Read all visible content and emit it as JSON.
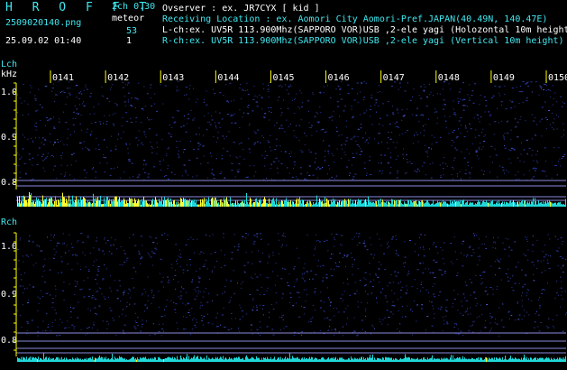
{
  "header": {
    "title": "H R O F F T",
    "version": "2ch 0.30",
    "mode_label": "meteor",
    "count_l": "53",
    "count_r": "1",
    "filename": "2509020140.png",
    "datetime": "25.09.02 01:40",
    "observer": "Ovserver          : ex. JR7CYX [ kid ]",
    "location": "Receiving Location : ex. Aomori City Aomori-Pref.JAPAN(40.49N, 140.47E)",
    "lch_info": "L-ch:ex. UV5R 113.900Mhz(SAPPORO VOR)USB ,2-ele yagi (Holozontal 10m height",
    "rch_info": "R-ch:ex. UV5R 113.900Mhz(SAPPORO VOR)USB ,2-ele yagi (Vertical 10m height)"
  },
  "panels": {
    "left_label": "Lch",
    "unit": "kHz",
    "right_label": "Rch"
  },
  "colors": {
    "background": "#000000",
    "text_cyan": "#40e8f0",
    "text_white": "#ffffff",
    "axis_yellow": "#ffff00",
    "grid_line": "#8a8ae0",
    "noise": "#2a3aa8",
    "spectrum_cyan": "#20d8d8",
    "spectrum_yellow": "#ffff30"
  },
  "chart_data": {
    "type": "heatmap",
    "x": [
      "0141",
      "0142",
      "0143",
      "0144",
      "0145",
      "0146",
      "0147",
      "0148",
      "0149",
      "0150"
    ],
    "y_ticks_l": [
      "1.0",
      "0.9",
      "0.8"
    ],
    "y_ticks_r": [
      "1.0",
      "0.9",
      "0.8"
    ],
    "ylabel": "kHz",
    "grid": true
  }
}
